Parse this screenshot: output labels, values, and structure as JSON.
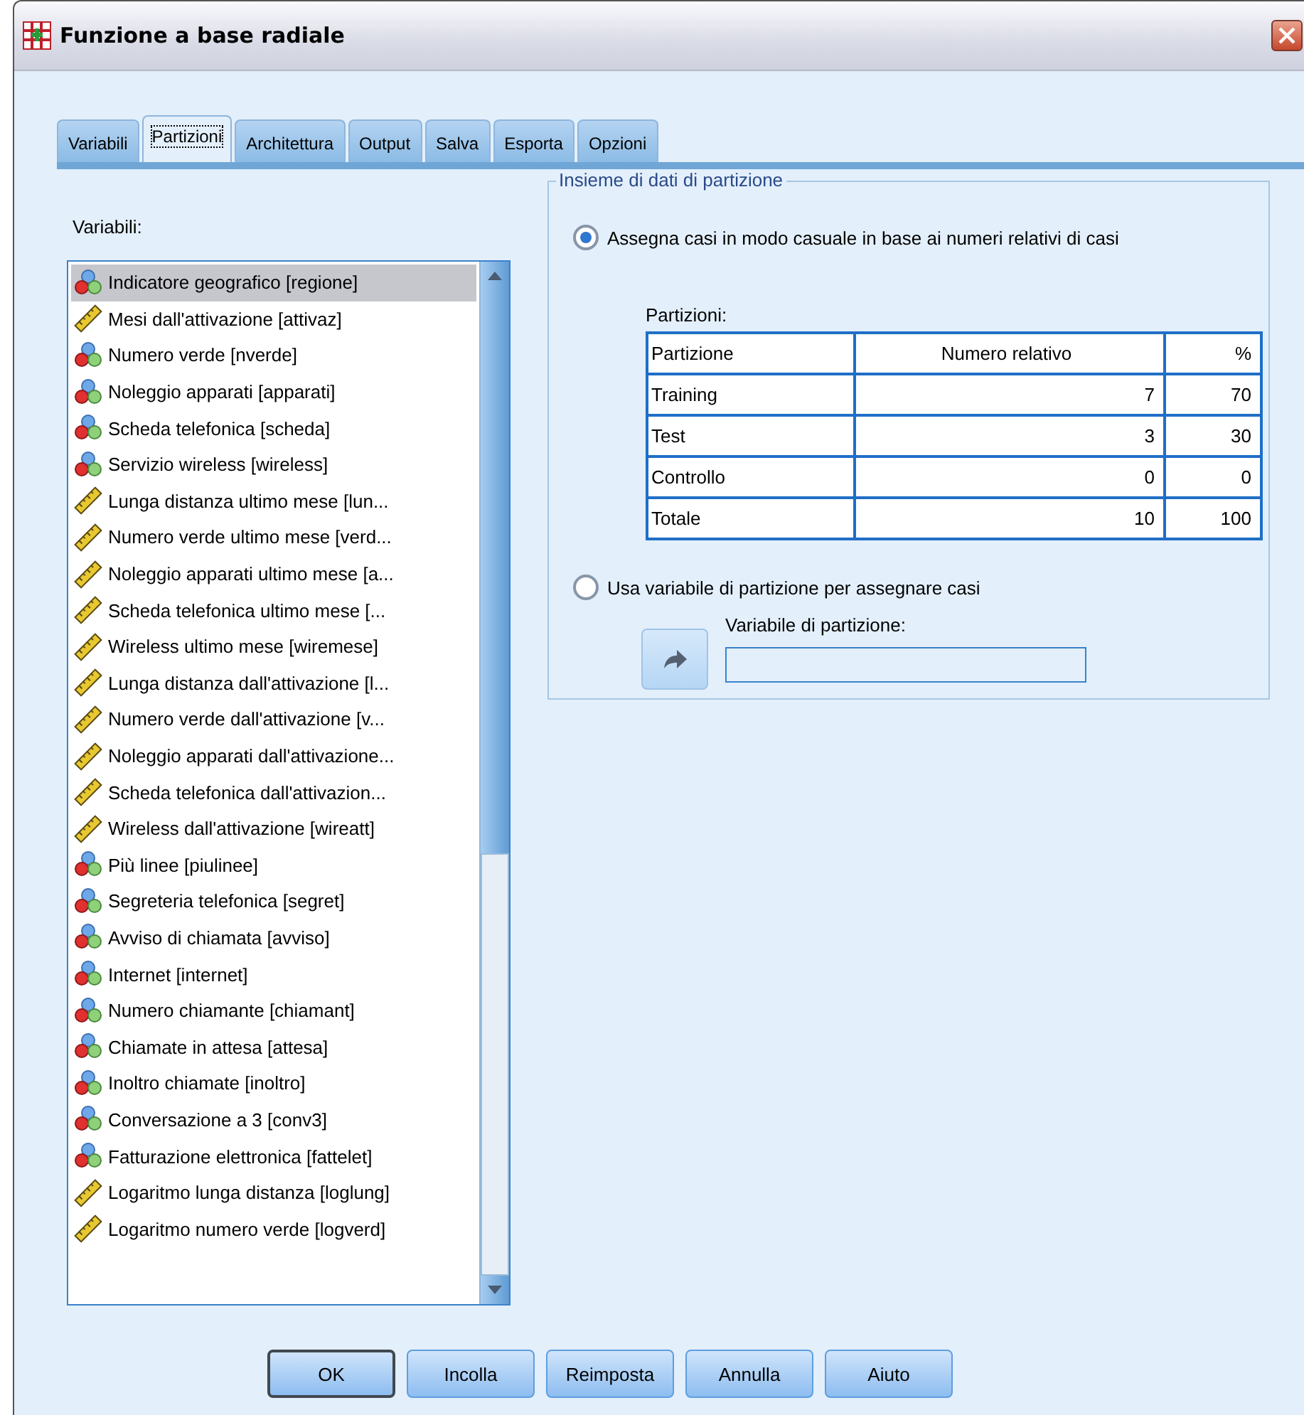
{
  "window": {
    "title": "Funzione a base radiale"
  },
  "tabs": [
    {
      "label": "Variabili",
      "selected": false
    },
    {
      "label": "Partizioni",
      "selected": true
    },
    {
      "label": "Architettura",
      "selected": false
    },
    {
      "label": "Output",
      "selected": false
    },
    {
      "label": "Salva",
      "selected": false
    },
    {
      "label": "Esporta",
      "selected": false
    },
    {
      "label": "Opzioni",
      "selected": false
    }
  ],
  "variables": {
    "label": "Variabili:",
    "items": [
      {
        "text": "Indicatore geografico [regione]",
        "kind": "nominal",
        "selected": true
      },
      {
        "text": "Mesi dall'attivazione [attivaz]",
        "kind": "scale",
        "selected": false
      },
      {
        "text": "Numero verde [nverde]",
        "kind": "nominal",
        "selected": false
      },
      {
        "text": "Noleggio apparati [apparati]",
        "kind": "nominal",
        "selected": false
      },
      {
        "text": "Scheda telefonica [scheda]",
        "kind": "nominal",
        "selected": false
      },
      {
        "text": "Servizio wireless [wireless]",
        "kind": "nominal",
        "selected": false
      },
      {
        "text": "Lunga distanza ultimo mese [lun...",
        "kind": "scale",
        "selected": false
      },
      {
        "text": "Numero verde ultimo mese [verd...",
        "kind": "scale",
        "selected": false
      },
      {
        "text": "Noleggio apparati ultimo mese [a...",
        "kind": "scale",
        "selected": false
      },
      {
        "text": "Scheda telefonica ultimo mese [...",
        "kind": "scale",
        "selected": false
      },
      {
        "text": "Wireless ultimo mese [wiremese]",
        "kind": "scale",
        "selected": false
      },
      {
        "text": "Lunga distanza dall'attivazione [l...",
        "kind": "scale",
        "selected": false
      },
      {
        "text": "Numero verde dall'attivazione [v...",
        "kind": "scale",
        "selected": false
      },
      {
        "text": "Noleggio apparati dall'attivazione...",
        "kind": "scale",
        "selected": false
      },
      {
        "text": "Scheda telefonica dall'attivazion...",
        "kind": "scale",
        "selected": false
      },
      {
        "text": "Wireless dall'attivazione [wireatt]",
        "kind": "scale",
        "selected": false
      },
      {
        "text": "Più linee [piulinee]",
        "kind": "nominal",
        "selected": false
      },
      {
        "text": "Segreteria telefonica [segret]",
        "kind": "nominal",
        "selected": false
      },
      {
        "text": "Avviso di chiamata [avviso]",
        "kind": "nominal",
        "selected": false
      },
      {
        "text": "Internet [internet]",
        "kind": "nominal",
        "selected": false
      },
      {
        "text": "Numero chiamante [chiamant]",
        "kind": "nominal",
        "selected": false
      },
      {
        "text": "Chiamate in attesa [attesa]",
        "kind": "nominal",
        "selected": false
      },
      {
        "text": "Inoltro chiamate [inoltro]",
        "kind": "nominal",
        "selected": false
      },
      {
        "text": "Conversazione a 3 [conv3]",
        "kind": "nominal",
        "selected": false
      },
      {
        "text": "Fatturazione elettronica [fattelet]",
        "kind": "nominal",
        "selected": false
      },
      {
        "text": "Logaritmo lunga distanza [loglung]",
        "kind": "scale",
        "selected": false
      },
      {
        "text": "Logaritmo numero verde [logverd]",
        "kind": "scale",
        "selected": false
      }
    ]
  },
  "partition_group": {
    "title": "Insieme di dati di partizione",
    "random_option": {
      "label": "Assegna casi in modo casuale in base ai numeri relativi di casi",
      "selected": true
    },
    "table_label": "Partizioni:",
    "columns": [
      "Partizione",
      "Numero relativo",
      "%"
    ],
    "rows": [
      [
        "Training",
        "7",
        "70"
      ],
      [
        "Test",
        "3",
        "30"
      ],
      [
        "Controllo",
        "0",
        "0"
      ],
      [
        "Totale",
        "10",
        "100"
      ]
    ],
    "variable_option": {
      "label": "Usa variabile di partizione per assegnare casi",
      "selected": false
    },
    "field_label": "Variabile di partizione:"
  },
  "buttons": [
    {
      "label": "OK",
      "default": true
    },
    {
      "label": "Incolla",
      "default": false
    },
    {
      "label": "Reimposta",
      "default": false
    },
    {
      "label": "Annulla",
      "default": false
    },
    {
      "label": "Aiuto",
      "default": false
    }
  ]
}
